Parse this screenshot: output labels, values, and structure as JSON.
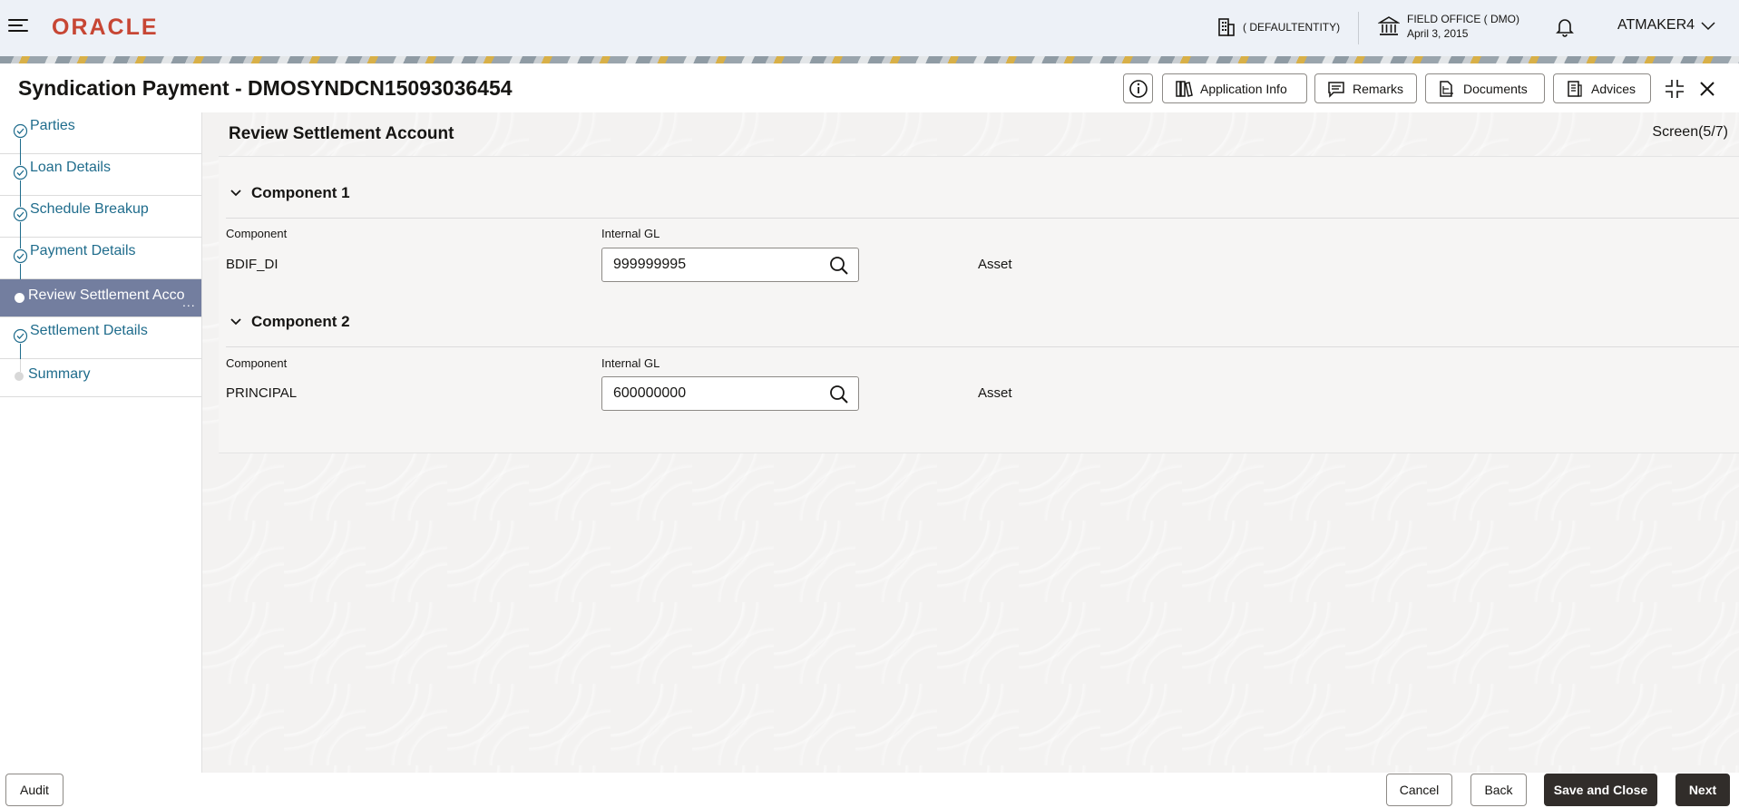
{
  "topbar": {
    "logo": "ORACLE",
    "entity": "( DEFAULTENTITY)",
    "office_name": "FIELD OFFICE ( DMO)",
    "office_date": "April 3, 2015",
    "user": "ATMAKER4"
  },
  "header": {
    "title": "Syndication Payment - DMOSYNDCN15093036454",
    "buttons": {
      "application_info": "Application Info",
      "remarks": "Remarks",
      "documents": "Documents",
      "advices": "Advices"
    }
  },
  "sidebar": {
    "steps": [
      {
        "label": "Parties",
        "state": "done"
      },
      {
        "label": "Loan Details",
        "state": "done"
      },
      {
        "label": "Schedule Breakup",
        "state": "done"
      },
      {
        "label": "Payment Details",
        "state": "done"
      },
      {
        "label": "Review Settlement Acco",
        "state": "active"
      },
      {
        "label": "Settlement Details",
        "state": "done"
      },
      {
        "label": "Summary",
        "state": "future"
      }
    ],
    "active_more": "..."
  },
  "main": {
    "section_title": "Review Settlement Account",
    "screen": "Screen(5/7)",
    "components": [
      {
        "heading": "Component 1",
        "component_label": "Component",
        "gl_label": "Internal GL",
        "component": "BDIF_DI",
        "gl_value": "999999995",
        "type": "Asset"
      },
      {
        "heading": "Component 2",
        "component_label": "Component",
        "gl_label": "Internal GL",
        "component": "PRINCIPAL",
        "gl_value": "600000000",
        "type": "Asset"
      }
    ]
  },
  "footer": {
    "audit": "Audit",
    "cancel": "Cancel",
    "back": "Back",
    "save_close": "Save and Close",
    "next": "Next"
  },
  "colors": {
    "brand": "#c74634",
    "link": "#1f6c8c",
    "active_step": "#737e9f",
    "primary_button": "#312d2a"
  },
  "icons": [
    "hamburger-menu-icon",
    "building-icon",
    "bank-icon",
    "bell-icon",
    "chevron-down-icon",
    "info-icon",
    "application-info-icon",
    "remarks-icon",
    "documents-icon",
    "advices-icon",
    "collapse-icon",
    "close-icon",
    "check-circle-icon",
    "search-icon"
  ]
}
